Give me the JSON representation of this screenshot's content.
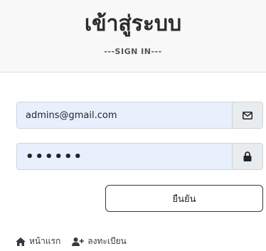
{
  "header": {
    "title": "เข้าสู่ระบบ",
    "subtitle": "---SIGN IN---"
  },
  "form": {
    "email_value": "admins@gmail.com",
    "email_icon": "envelope-icon",
    "password_value": "••••••",
    "password_icon": "lock-icon",
    "submit_label": "ยืนยัน"
  },
  "footer_links": {
    "home_label": "หน้าแรก",
    "home_icon": "home-icon",
    "register_label": "ลงทะเบียน",
    "register_icon": "user-plus-icon"
  },
  "colors": {
    "input_autofill_bg": "#e8f0fe",
    "header_bg": "#f8f8f8"
  }
}
